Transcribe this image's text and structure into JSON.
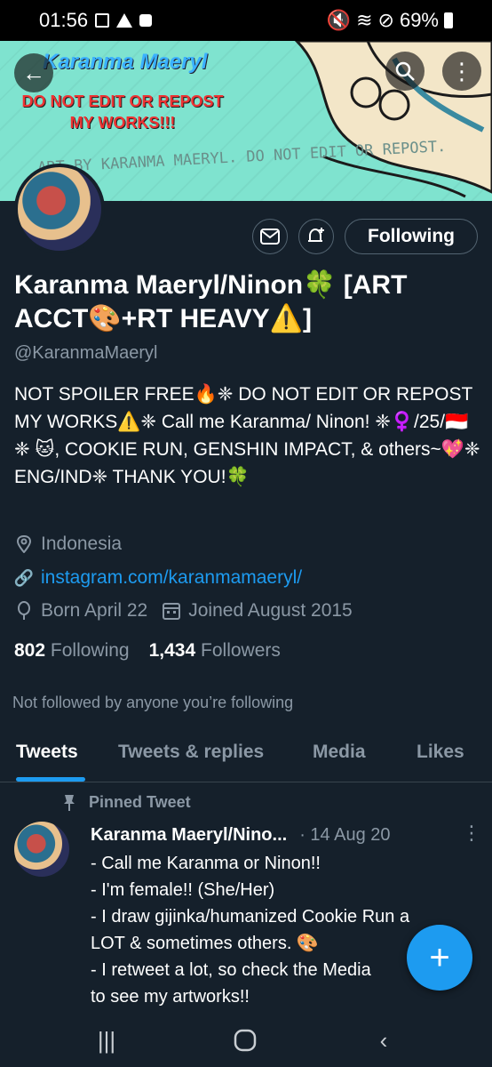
{
  "status_bar": {
    "time": "01:56",
    "battery": "69%"
  },
  "banner": {
    "name": "Karanma Maeryl",
    "warning": "DO NOT EDIT OR REPOST MY WORKS!!!",
    "credit": "ART BY KARANMA MAERYL. DO NOT EDIT OR REPOST.",
    "bg_color": "#7fe3cf"
  },
  "profile": {
    "display_name": "Karanma Maeryl/Ninon🍀 [ART ACCT🎨+RT HEAVY⚠️]",
    "handle": "@KaranmaMaeryl",
    "bio": "NOT SPOILER FREE🔥❈ DO NOT EDIT OR REPOST MY WORKS⚠️❈ Call me Karanma/ Ninon! ❈♀️/25/🇮🇩❈ 🐱, COOKIE RUN, GENSHIN IMPACT, & others~💖❈ ENG/IND❈ THANK YOU!🍀",
    "location": "Indonesia",
    "link": "instagram.com/karanmamaeryl/",
    "born": "Born April 22",
    "joined": "Joined August 2015",
    "following_count": "802",
    "following_label": "Following",
    "followers_count": "1,434",
    "followers_label": "Followers",
    "not_followed": "Not followed by anyone you’re following"
  },
  "actions": {
    "following_button": "Following"
  },
  "tabs": [
    {
      "label": "Tweets",
      "active": true
    },
    {
      "label": "Tweets & replies",
      "active": false
    },
    {
      "label": "Media",
      "active": false
    },
    {
      "label": "Likes",
      "active": false
    }
  ],
  "tweet": {
    "pinned_label": "Pinned Tweet",
    "author": "Karanma Maeryl/Nino...",
    "date": "· 14 Aug 20",
    "lines": [
      "- Call me Karanma or Ninon!!",
      "- I'm female!! (She/Her)",
      "- I draw gijinka/humanized Cookie Run a",
      "LOT & sometimes others. 🎨",
      "- I retweet a lot, so check the Media",
      "to see my artworks!!"
    ]
  },
  "icons": {
    "back": "back-arrow-icon",
    "search": "search-icon",
    "more": "more-vertical-icon",
    "mail": "mail-icon",
    "bell": "bell-plus-icon",
    "location": "location-pin-icon",
    "link": "link-icon",
    "birthday": "balloon-icon",
    "calendar": "calendar-icon",
    "pin": "pin-icon",
    "compose": "plus-icon"
  },
  "colors": {
    "accent": "#1d9bf0",
    "background": "#15202b",
    "muted": "#8b98a5"
  }
}
